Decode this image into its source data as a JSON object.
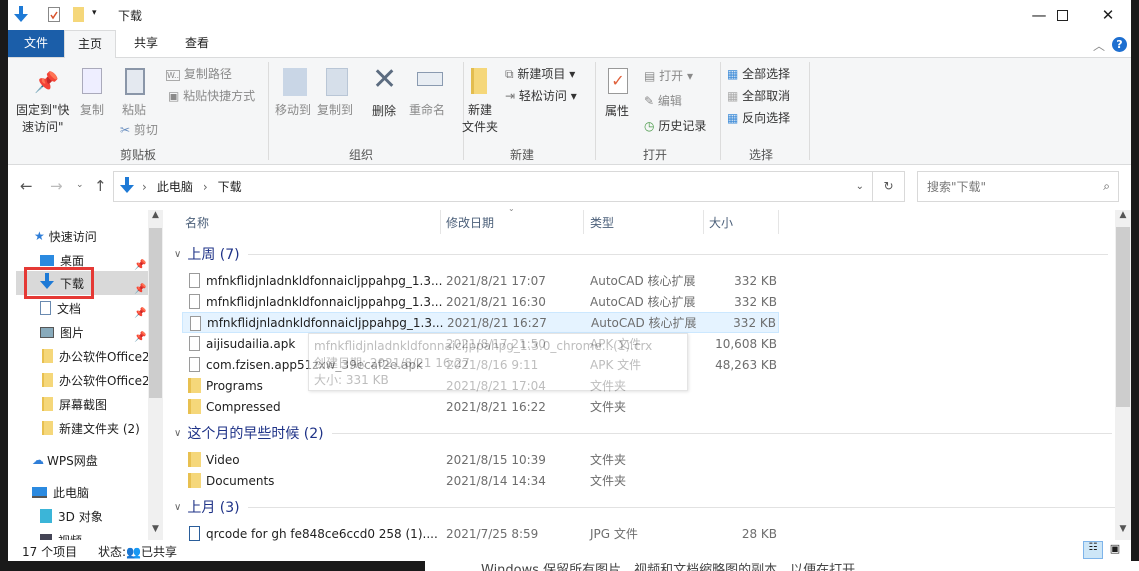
{
  "window": {
    "title": "下载"
  },
  "tabs": {
    "file": "文件",
    "home": "主页",
    "share": "共享",
    "view": "查看"
  },
  "ribbon": {
    "clipboard": {
      "pin": "固定到\"快速访问\"",
      "pin1": "固定到\"快",
      "pin2": "速访问\"",
      "copy": "复制",
      "paste": "粘贴",
      "copy_path": "复制路径",
      "paste_shortcut": "粘贴快捷方式",
      "cut": "剪切",
      "group": "剪贴板"
    },
    "organize": {
      "move_to": "移动到",
      "copy_to": "复制到",
      "delete": "删除",
      "rename": "重命名",
      "group": "组织"
    },
    "new": {
      "new_item": "新建项目",
      "easy_access": "轻松访问",
      "new_folder1": "新建",
      "new_folder2": "文件夹",
      "group": "新建"
    },
    "open": {
      "properties": "属性",
      "open": "打开",
      "edit": "编辑",
      "history": "历史记录",
      "group": "打开"
    },
    "select": {
      "select_all": "全部选择",
      "select_none": "全部取消",
      "invert": "反向选择",
      "group": "选择"
    }
  },
  "address": {
    "crumbs": [
      "此电脑",
      "下载"
    ],
    "search_placeholder": "搜索\"下载\""
  },
  "nav": {
    "quick_access": "快速访问",
    "items": [
      {
        "label": "桌面",
        "pinned": true
      },
      {
        "label": "下载",
        "pinned": true
      },
      {
        "label": "文档",
        "pinned": true
      },
      {
        "label": "图片",
        "pinned": true
      },
      {
        "label": "办公软件Office2"
      },
      {
        "label": "办公软件Office2"
      },
      {
        "label": "屏幕截图"
      },
      {
        "label": "新建文件夹 (2)"
      }
    ],
    "wps": "WPS网盘",
    "this_pc": "此电脑",
    "objects3d": "3D 对象",
    "videos": "视频"
  },
  "columns": {
    "name": "名称",
    "date": "修改日期",
    "type": "类型",
    "size": "大小"
  },
  "groups": [
    {
      "title": "上周 (7)",
      "files": [
        {
          "name": "mfnkflidjnladnkldfonnaicljppahpg_1.3...",
          "date": "2021/8/21 17:07",
          "type": "AutoCAD 核心扩展",
          "size": "332 KB",
          "kind": "file"
        },
        {
          "name": "mfnkflidjnladnkldfonnaicljppahpg_1.3...",
          "date": "2021/8/21 16:30",
          "type": "AutoCAD 核心扩展",
          "size": "332 KB",
          "kind": "file"
        },
        {
          "name": "mfnkflidjnladnkldfonnaicljppahpg_1.3...",
          "date": "2021/8/21 16:27",
          "type": "AutoCAD 核心扩展",
          "size": "332 KB",
          "kind": "file"
        },
        {
          "name": "aijisudailia.apk",
          "date": "2021/8/17 21:50",
          "type": "APK 文件",
          "size": "10,608 KB",
          "kind": "file"
        },
        {
          "name": "com.fzisen.app51zxw_39ecaf2e.apk",
          "date": "2021/8/16 9:11",
          "type": "APK 文件",
          "size": "48,263 KB",
          "kind": "file"
        },
        {
          "name": "Programs",
          "date": "2021/8/21 17:04",
          "type": "文件夹",
          "size": "",
          "kind": "folder"
        },
        {
          "name": "Compressed",
          "date": "2021/8/21 16:22",
          "type": "文件夹",
          "size": "",
          "kind": "folder"
        }
      ]
    },
    {
      "title": "这个月的早些时候 (2)",
      "files": [
        {
          "name": "Video",
          "date": "2021/8/15 10:39",
          "type": "文件夹",
          "size": "",
          "kind": "folder"
        },
        {
          "name": "Documents",
          "date": "2021/8/14 14:34",
          "type": "文件夹",
          "size": "",
          "kind": "folder"
        }
      ]
    },
    {
      "title": "上月 (3)",
      "files": [
        {
          "name": "qrcode for gh fe848ce6ccd0 258 (1)....",
          "date": "2021/7/25 8:59",
          "type": "JPG 文件",
          "size": "28 KB",
          "kind": "image"
        }
      ]
    }
  ],
  "tooltip": {
    "name": "mfnkflidjnladnkldfonnaicljppahpg_1.3.0_chrome...(1).crx",
    "created": "创建日期: 2021/8/21 16:27",
    "size": "大小: 331 KB"
  },
  "status": {
    "count": "17 个项目",
    "state_label": "状态:",
    "shared": "已共享"
  },
  "background_text": "Windows 保留所有图片、视频和文档缩略图的副本，以便在打开"
}
